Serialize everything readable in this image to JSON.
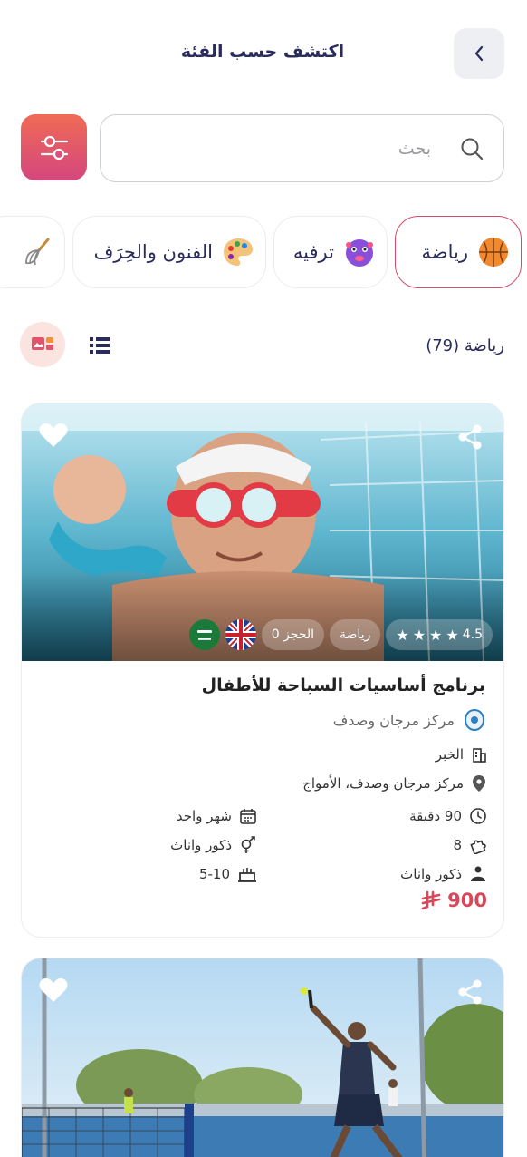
{
  "header": {
    "title": "اكتشف حسب الفئة",
    "back_icon": "chevron-left-icon"
  },
  "search": {
    "placeholder": "بحث",
    "value": ""
  },
  "filter_icon": "sliders-icon",
  "categories": [
    {
      "label": "رياضة",
      "icon": "basketball-icon",
      "active": true
    },
    {
      "label": "ترفيه",
      "icon": "ball-toy-icon",
      "active": false
    },
    {
      "label": "الفنون والحِرَف",
      "icon": "palette-icon",
      "active": false
    },
    {
      "label": "",
      "icon": "whisk-icon",
      "active": false
    }
  ],
  "list_bar": {
    "count_label": "رياضة (79)"
  },
  "cards": [
    {
      "title": "برنامج أساسيات السباحة للأطفال",
      "provider": "مركز مرجان وصدف",
      "rating": "4.5",
      "category_badge": "رياضة",
      "booking_badge": "الحجز 0",
      "city": "الخبر",
      "location": "مركز مرجان وصدف، الأمواج",
      "duration": "90 دقيقة",
      "period": "شهر واحد",
      "capacity": "8",
      "gender": "ذكور واناث",
      "audience": "ذكور واناث",
      "age": "5-10",
      "price": "900"
    },
    {
      "title": "",
      "provider": ""
    }
  ],
  "colors": {
    "accent": "#d9475a",
    "title_text": "#2a2d5c",
    "chip_active_border": "#d44a6a"
  }
}
